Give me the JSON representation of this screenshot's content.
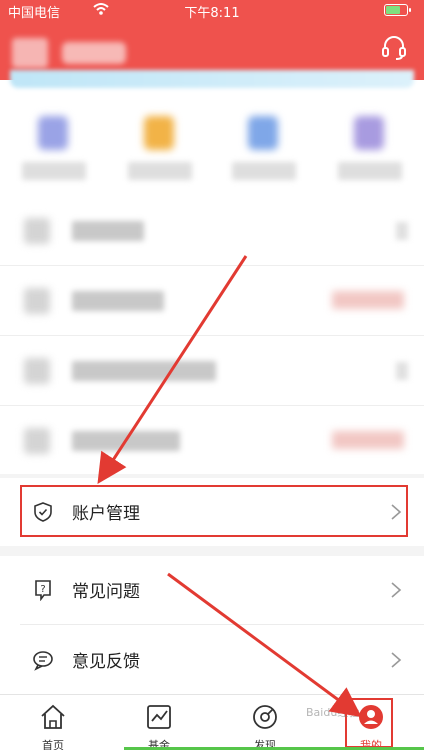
{
  "status": {
    "carrier": "中国电信",
    "time": "下午8:11"
  },
  "menu": {
    "account": "账户管理",
    "faq": "常见问题",
    "feedback": "意见反馈"
  },
  "tabs": [
    {
      "label": "首页",
      "icon": "home-icon"
    },
    {
      "label": "基金",
      "icon": "chart-icon"
    },
    {
      "label": "发现",
      "icon": "discover-icon"
    },
    {
      "label": "我的",
      "icon": "profile-icon"
    }
  ],
  "colors": {
    "brand": "#ef524d",
    "annotation": "#e23a32",
    "active_tab": "#e23a32"
  },
  "watermark": "Baidu经验"
}
